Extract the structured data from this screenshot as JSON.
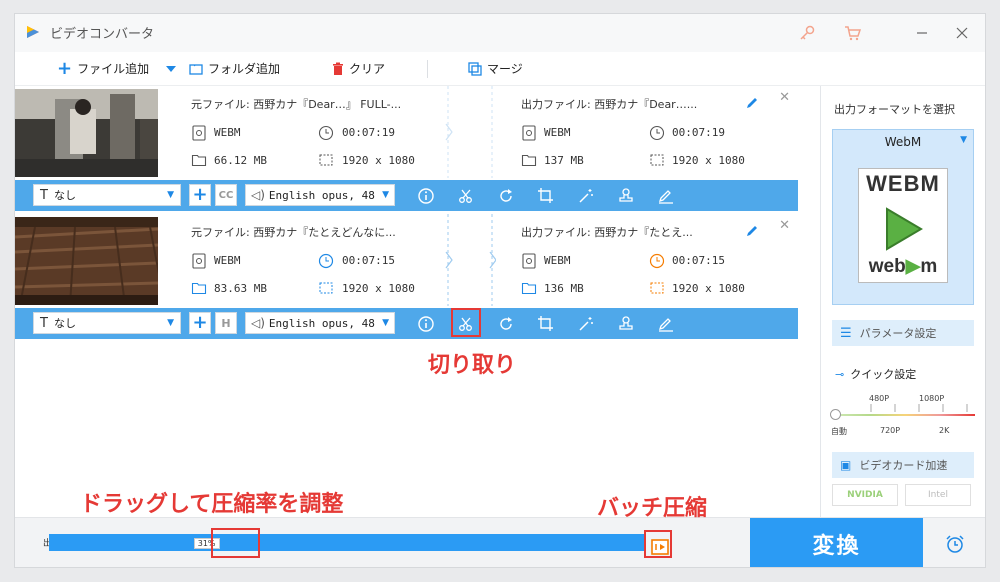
{
  "window": {
    "title": "ビデオコンバータ"
  },
  "toolbar": {
    "add_file": "ファイル追加",
    "add_folder": "フォルダ追加",
    "clear": "クリア",
    "merge": "マージ"
  },
  "files": [
    {
      "source_prefix": "元ファイル: ",
      "source_name": "西野カナ『Dear…』 FULL-...",
      "source_format": "WEBM",
      "source_duration": "00:07:19",
      "source_size": "66.12 MB",
      "source_resolution": "1920 x 1080",
      "output_prefix": "出力ファイル: ",
      "output_name": "西野カナ『Dear…...",
      "output_format": "WEBM",
      "output_duration": "00:07:19",
      "output_size": "137 MB",
      "output_resolution": "1920 x 1080",
      "subtitle": "なし",
      "audio": "English opus, 48",
      "subtitle_extra_icon": "cc-icon"
    },
    {
      "source_prefix": "元ファイル: ",
      "source_name": "西野カナ『たとえどんなに...",
      "source_format": "WEBM",
      "source_duration": "00:07:15",
      "source_size": "83.63 MB",
      "source_resolution": "1920 x 1080",
      "output_prefix": "出力ファイル: ",
      "output_name": "西野カナ『たとえ...",
      "output_format": "WEBM",
      "output_duration": "00:07:15",
      "output_size": "136 MB",
      "output_resolution": "1920 x 1080",
      "subtitle": "なし",
      "audio": "English opus, 48",
      "subtitle_extra_icon": "h-icon"
    }
  ],
  "right_panel": {
    "heading": "出力フォーマットを選択",
    "format_name": "WebM",
    "logo_top": "WEBM",
    "logo_bottom": "web",
    "logo_bottom_2": "m",
    "param_button": "パラメータ設定",
    "quick_title": "クイック設定",
    "slider_labels_top": [
      "480P",
      "1080P"
    ],
    "slider_labels_bottom": [
      "自動",
      "720P",
      "2K"
    ],
    "gpu_button": "ビデオカード加速",
    "gpu_badges": [
      "NVIDIA",
      "Intel"
    ]
  },
  "bottom": {
    "compress_label": "出",
    "compress_value": "31%",
    "compress_fraction": 0.31,
    "convert_button": "変換"
  },
  "annotations": {
    "cut": "切り取り",
    "drag": "ドラッグして圧縮率を調整",
    "batch": "バッチ圧縮"
  },
  "colors": {
    "accent": "#2b9bf4",
    "bar": "#4fa8ea",
    "annotation": "#e53935",
    "convert": "#2b9bf4"
  }
}
